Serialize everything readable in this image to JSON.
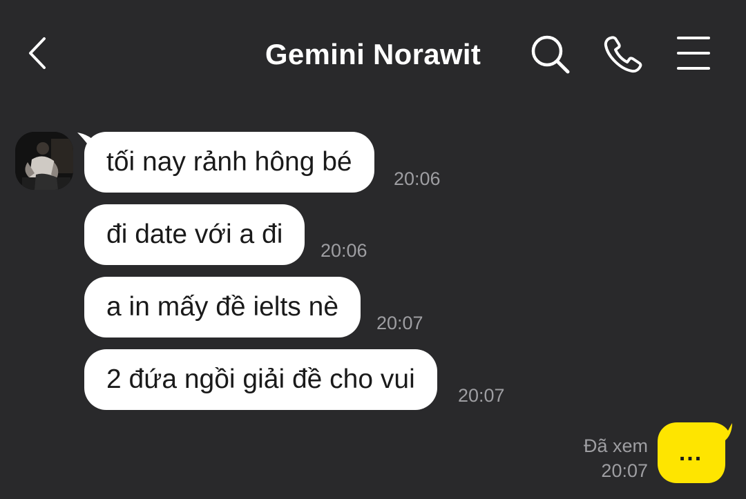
{
  "header": {
    "title": "Gemini Norawit",
    "back_icon": "chevron-left-icon",
    "search_icon": "search-icon",
    "call_icon": "phone-icon",
    "menu_icon": "menu-icon"
  },
  "colors": {
    "background": "#29292b",
    "incoming_bubble": "#ffffff",
    "outgoing_bubble": "#fee500",
    "timestamp": "#9e9ea2",
    "header_text": "#ffffff"
  },
  "messages": [
    {
      "text": "tối nay rảnh hông bé",
      "time": "20:06"
    },
    {
      "text": "đi date với a đi",
      "time": "20:06"
    },
    {
      "text": "a in mấy đề ielts nè",
      "time": "20:07"
    },
    {
      "text": "2 đứa ngồi giải đề cho vui",
      "time": "20:07"
    }
  ],
  "outgoing": {
    "status": "Đã xem",
    "time": "20:07",
    "text": "..."
  }
}
